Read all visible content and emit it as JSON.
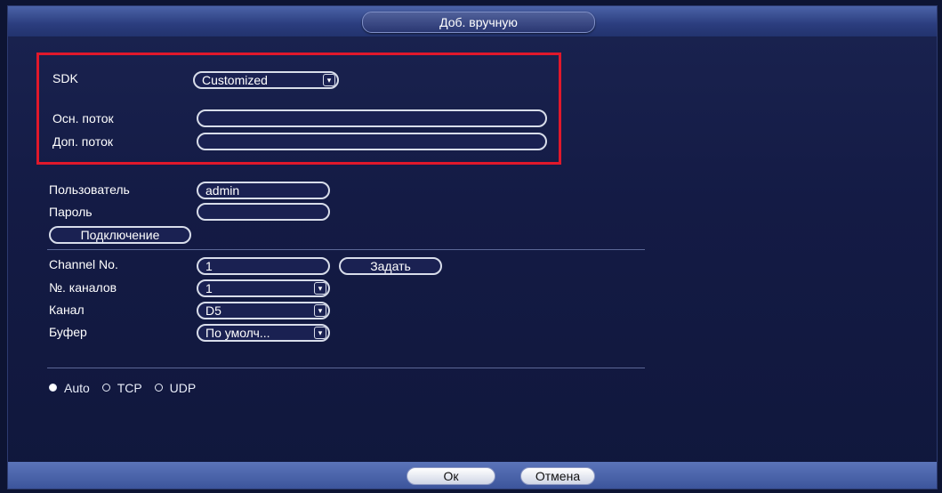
{
  "window": {
    "title": "Доб. вручную"
  },
  "sdk": {
    "label": "SDK",
    "value": "Customized",
    "arrow": "▾"
  },
  "main_stream": {
    "label": "Осн. поток",
    "value": ""
  },
  "sub_stream": {
    "label": "Доп. поток",
    "value": ""
  },
  "user": {
    "label": "Пользователь",
    "value": "admin"
  },
  "password": {
    "label": "Пароль",
    "value": ""
  },
  "connect_button": "Подключение",
  "channel_no": {
    "label": "Channel No.",
    "value": "1",
    "button": "Задать"
  },
  "channel_count": {
    "label": "№. каналов",
    "value": "1",
    "arrow": "▾"
  },
  "channel": {
    "label": "Канал",
    "value": "D5",
    "arrow": "▾"
  },
  "buffer": {
    "label": "Буфер",
    "value": "По умолч...",
    "arrow": "▾"
  },
  "protocol": {
    "options": [
      "Auto",
      "TCP",
      "UDP"
    ],
    "selected": "Auto"
  },
  "footer": {
    "ok": "Ок",
    "cancel": "Отмена"
  },
  "colors": {
    "highlight": "#e0182b",
    "background": "#141b45",
    "header": "#2b3d7e"
  }
}
